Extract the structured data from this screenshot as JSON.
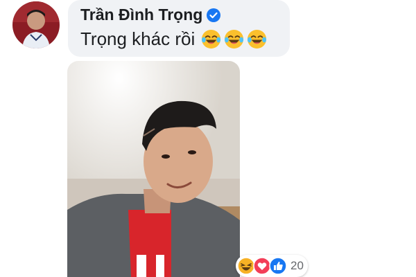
{
  "comment": {
    "author": "Trần Đình Trọng",
    "text": "Trọng khác rồi",
    "inline_emojis": [
      "laughing-tears-emoji",
      "laughing-tears-emoji",
      "laughing-tears-emoji"
    ],
    "verified_icon": "verified-badge-icon"
  },
  "reactions": {
    "icons": [
      "haha-reaction-icon",
      "love-reaction-icon",
      "like-reaction-icon"
    ],
    "count": "20"
  },
  "colors": {
    "bubble": "#f0f2f5",
    "verified_blue": "#1877f2",
    "love_red": "#f33e58",
    "like_blue": "#1877f2",
    "haha_yellow": "#f7b125"
  }
}
